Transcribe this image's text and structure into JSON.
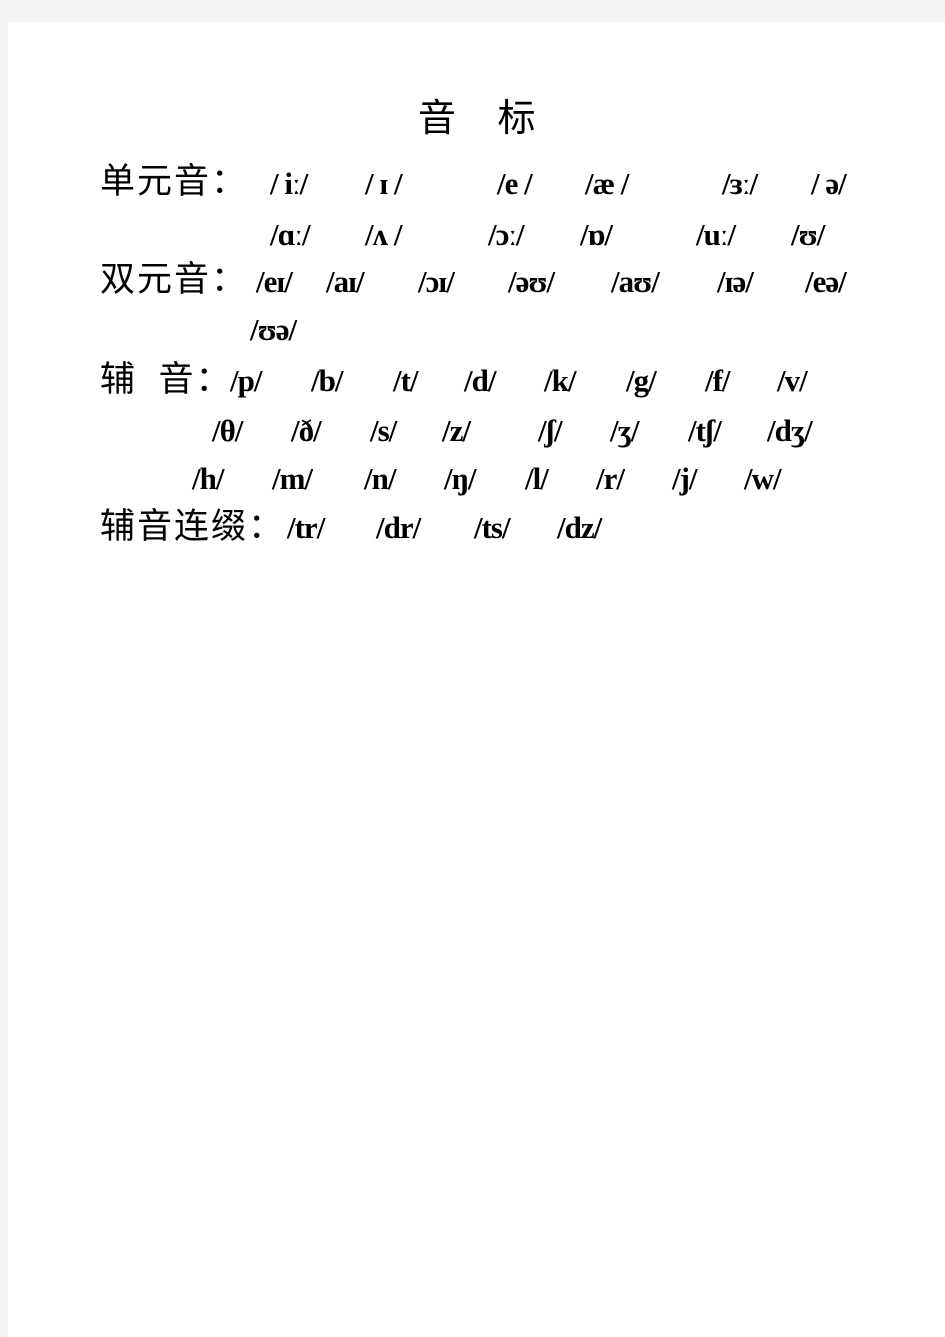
{
  "document": {
    "title": "音 标",
    "sections": [
      {
        "label": "单元音：",
        "rows": [
          [
            "/ iː/",
            "/ ɪ /",
            "/e /",
            "/æ /",
            "/ɜː/",
            "/ ə/"
          ],
          [
            "/ɑː/",
            "/ʌ /",
            "/ɔː/",
            "/ɒ/",
            "/uː/",
            "/ʊ/"
          ]
        ]
      },
      {
        "label": "双元音：",
        "rows": [
          [
            "/eɪ/",
            "/aɪ/",
            "/ɔɪ/",
            "/əʊ/",
            "/aʊ/",
            "/ɪə/",
            "/eə/"
          ],
          [
            "/ʊə/"
          ]
        ]
      },
      {
        "label": "辅  音：",
        "rows": [
          [
            "/p/",
            "/b/",
            "/t/",
            "/d/",
            "/k/",
            "/g/",
            "/f/",
            "/v/"
          ],
          [
            "/θ/",
            "/ð/",
            "/s/",
            "/z/",
            "/ʃ/",
            "/ʒ/",
            "/tʃ/",
            "/dʒ/"
          ],
          [
            "/h/",
            "/m/",
            "/n/",
            "/ŋ/",
            "/l/",
            "/r/",
            "/j/",
            "/w/"
          ]
        ]
      },
      {
        "label": "辅音连缀：",
        "rows": [
          [
            "/tr/",
            "/dr/",
            "/ts/",
            "/dz/"
          ]
        ]
      }
    ]
  }
}
